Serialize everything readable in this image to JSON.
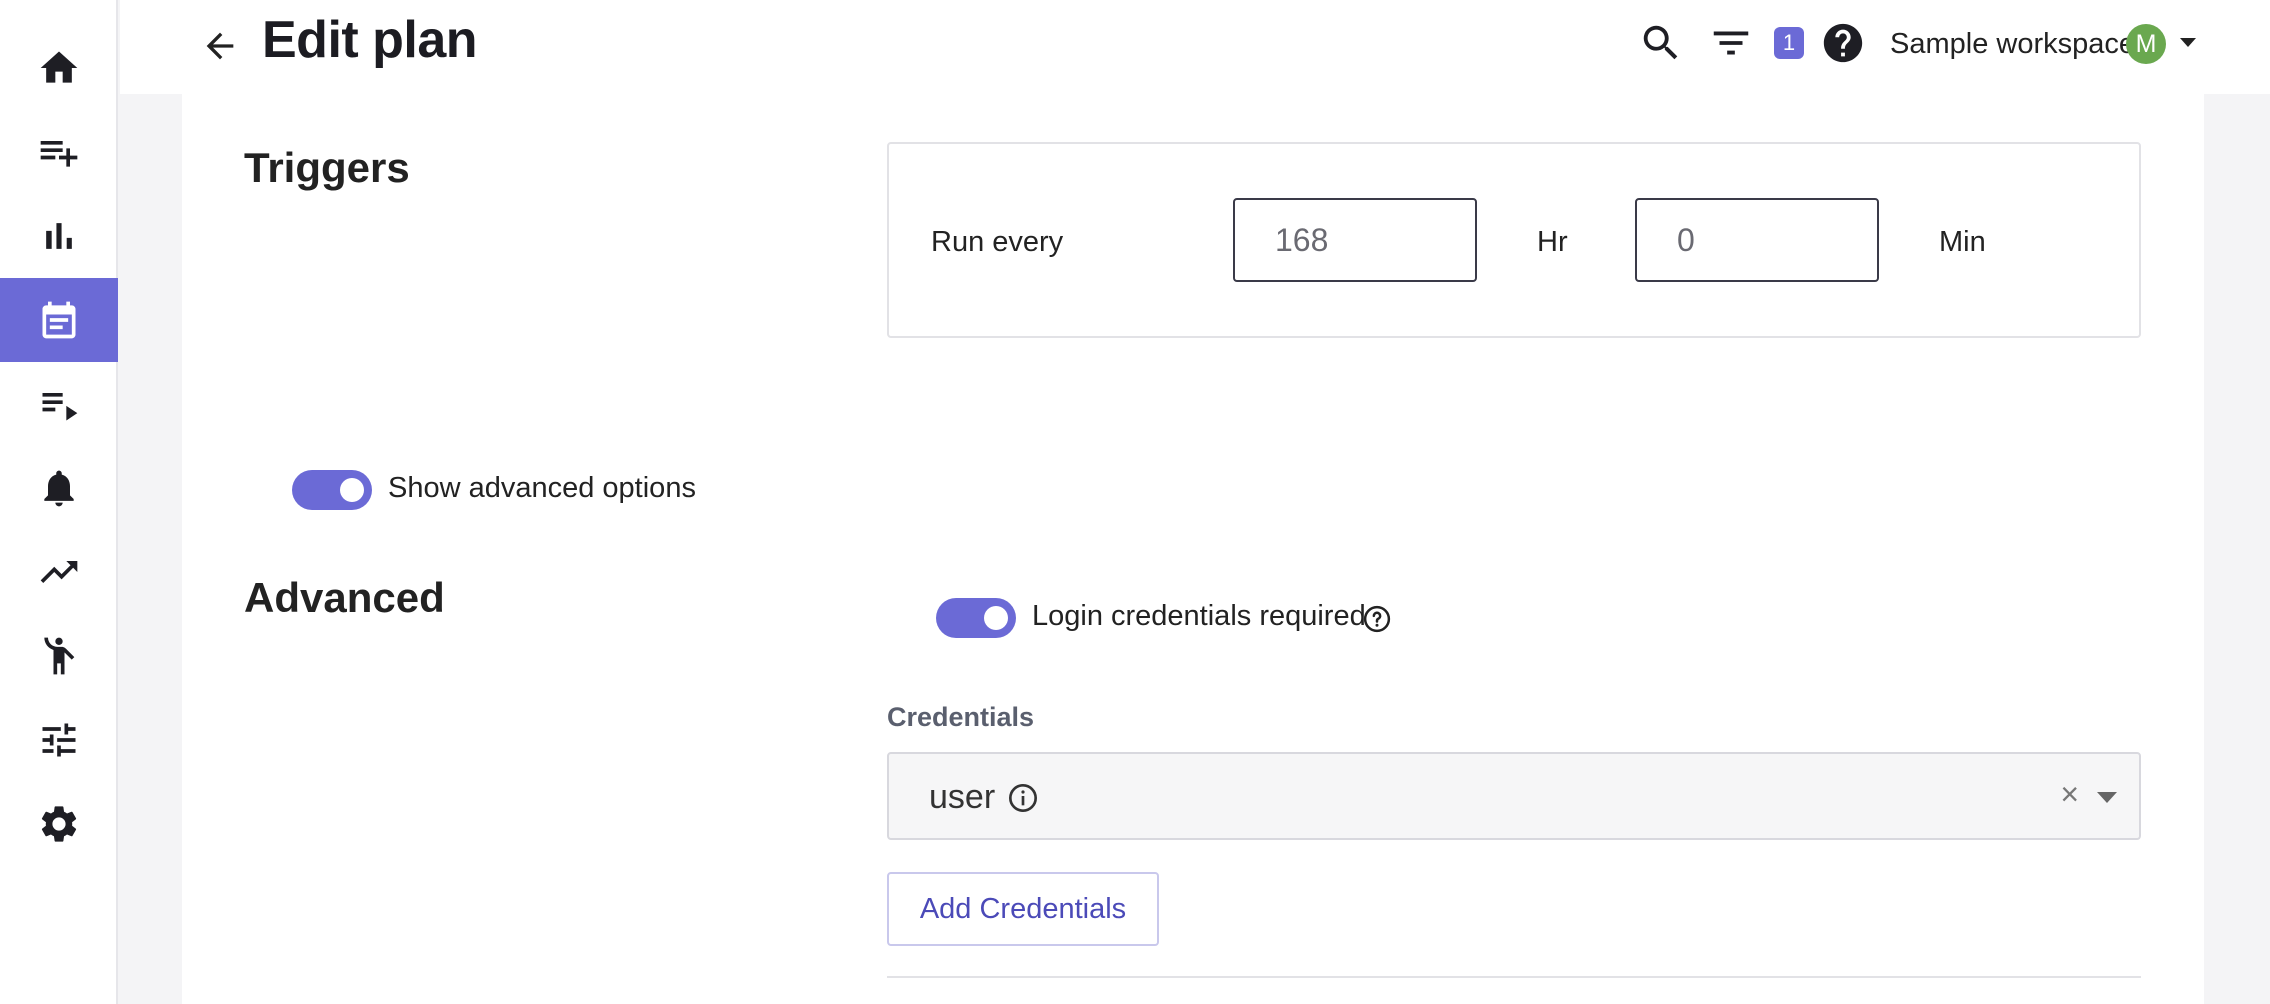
{
  "header": {
    "title": "Edit plan",
    "notification_count": "1",
    "workspace_name": "Sample workspace",
    "avatar_initial": "M"
  },
  "sidebar": {
    "active_index": 3,
    "items": [
      {
        "icon": "home-icon"
      },
      {
        "icon": "playlist-add-icon"
      },
      {
        "icon": "bar-chart-icon"
      },
      {
        "icon": "calendar-icon"
      },
      {
        "icon": "playlist-play-icon"
      },
      {
        "icon": "bell-icon"
      },
      {
        "icon": "trending-up-icon"
      },
      {
        "icon": "accessibility-icon"
      },
      {
        "icon": "tune-icon"
      },
      {
        "icon": "gear-icon"
      }
    ]
  },
  "triggers": {
    "title": "Triggers",
    "run_every_label": "Run every",
    "hours_value": "168",
    "hours_unit": "Hr",
    "minutes_value": "0",
    "minutes_unit": "Min"
  },
  "advanced_toggle": {
    "label": "Show advanced options",
    "on": true
  },
  "advanced": {
    "title": "Advanced",
    "login_toggle_label": "Login credentials required",
    "login_toggle_on": true,
    "credentials_label": "Credentials",
    "credentials_value": "user",
    "clear_symbol": "×",
    "add_button_label": "Add Credentials"
  },
  "colors": {
    "accent": "#6b6ad6",
    "avatar": "#6aa84f"
  }
}
